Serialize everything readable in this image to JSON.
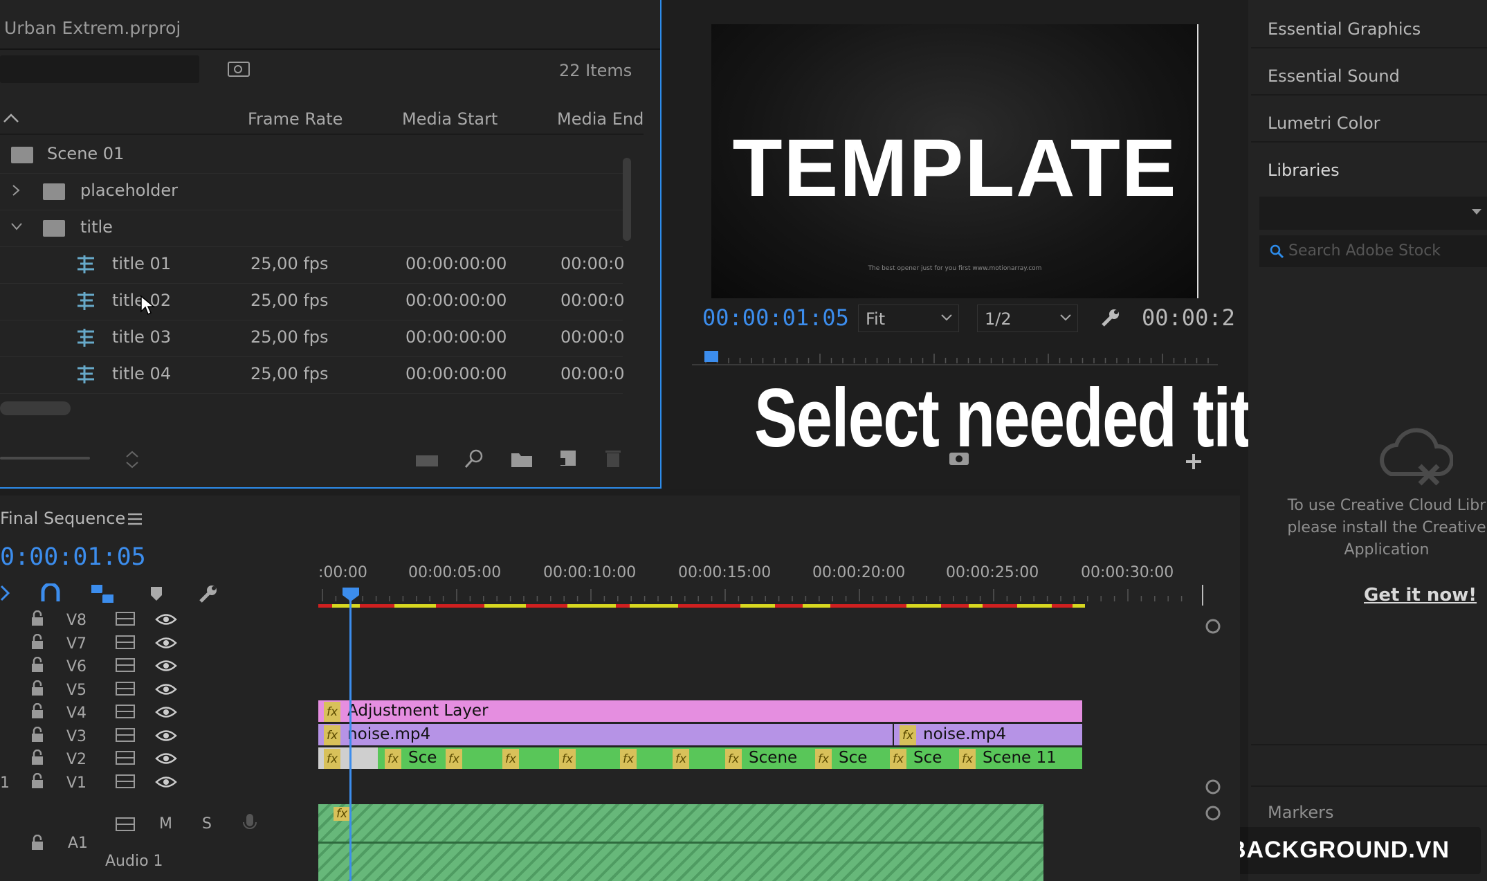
{
  "project_panel": {
    "title": "Urban Extrem.prproj",
    "item_count": "22 Items",
    "columns": [
      "Frame Rate",
      "Media Start",
      "Media End"
    ],
    "rows": [
      {
        "name": "Scene 01",
        "type": "folder",
        "frame_rate": "",
        "media_start": "",
        "media_end": ""
      },
      {
        "name": "placeholder",
        "type": "folder",
        "frame_rate": "",
        "media_start": "",
        "media_end": ""
      },
      {
        "name": "title",
        "type": "folder",
        "frame_rate": "",
        "media_start": "",
        "media_end": ""
      },
      {
        "name": "title 01",
        "type": "sequence",
        "frame_rate": "25,00 fps",
        "media_start": "00:00:00:00",
        "media_end": "00:00:0"
      },
      {
        "name": "title 02",
        "type": "sequence",
        "frame_rate": "25,00 fps",
        "media_start": "00:00:00:00",
        "media_end": "00:00:0"
      },
      {
        "name": "title 03",
        "type": "sequence",
        "frame_rate": "25,00 fps",
        "media_start": "00:00:00:00",
        "media_end": "00:00:0"
      },
      {
        "name": "title 04",
        "type": "sequence",
        "frame_rate": "25,00 fps",
        "media_start": "00:00:00:00",
        "media_end": "00:00:0"
      }
    ]
  },
  "program_monitor": {
    "preview_title": "TEMPLATE",
    "preview_subtitle": "The best opener just for you first\nwww.motionarray.com",
    "timecode": "00:00:01:05",
    "fit": "Fit",
    "resolution": "1/2",
    "duration": "00:00:2"
  },
  "overlay_caption": "Select needed title",
  "right_panel": {
    "items": [
      "Essential Graphics",
      "Essential Sound",
      "Lumetri Color",
      "Libraries"
    ],
    "search_placeholder": "Search Adobe Stock",
    "cc_message": "To use Creative Cloud Libr please install the Creative Application",
    "get_it_now": "Get it now!",
    "markers": "Markers",
    "watermark": "BACKGROUND.VN"
  },
  "timeline": {
    "sequence_name": "Final Sequence",
    "timecode": "0:00:01:05",
    "ruler": [
      ":00:00",
      "00:00:05:00",
      "00:00:10:00",
      "00:00:15:00",
      "00:00:20:00",
      "00:00:25:00",
      "00:00:30:00"
    ],
    "video_tracks": [
      "V8",
      "V7",
      "V6",
      "V5",
      "V4",
      "V3",
      "V2",
      "V1"
    ],
    "v1_prefix": "1",
    "audio_track": {
      "name": "A1",
      "label": "Audio 1",
      "mute": "M",
      "solo": "S"
    },
    "clips": {
      "v4": "Adjustment Layer",
      "v3a": "noise.mp4",
      "v3b": "noise.mp4",
      "v2": [
        "Sce",
        "Scene",
        "Sce",
        "Sce",
        "Scene 11"
      ]
    },
    "colors": {
      "adjustment": "#e58ee0",
      "noise": "#b693e6",
      "scene": "#59c659",
      "audio": "#67b87a",
      "playhead": "#3c8ded"
    }
  }
}
